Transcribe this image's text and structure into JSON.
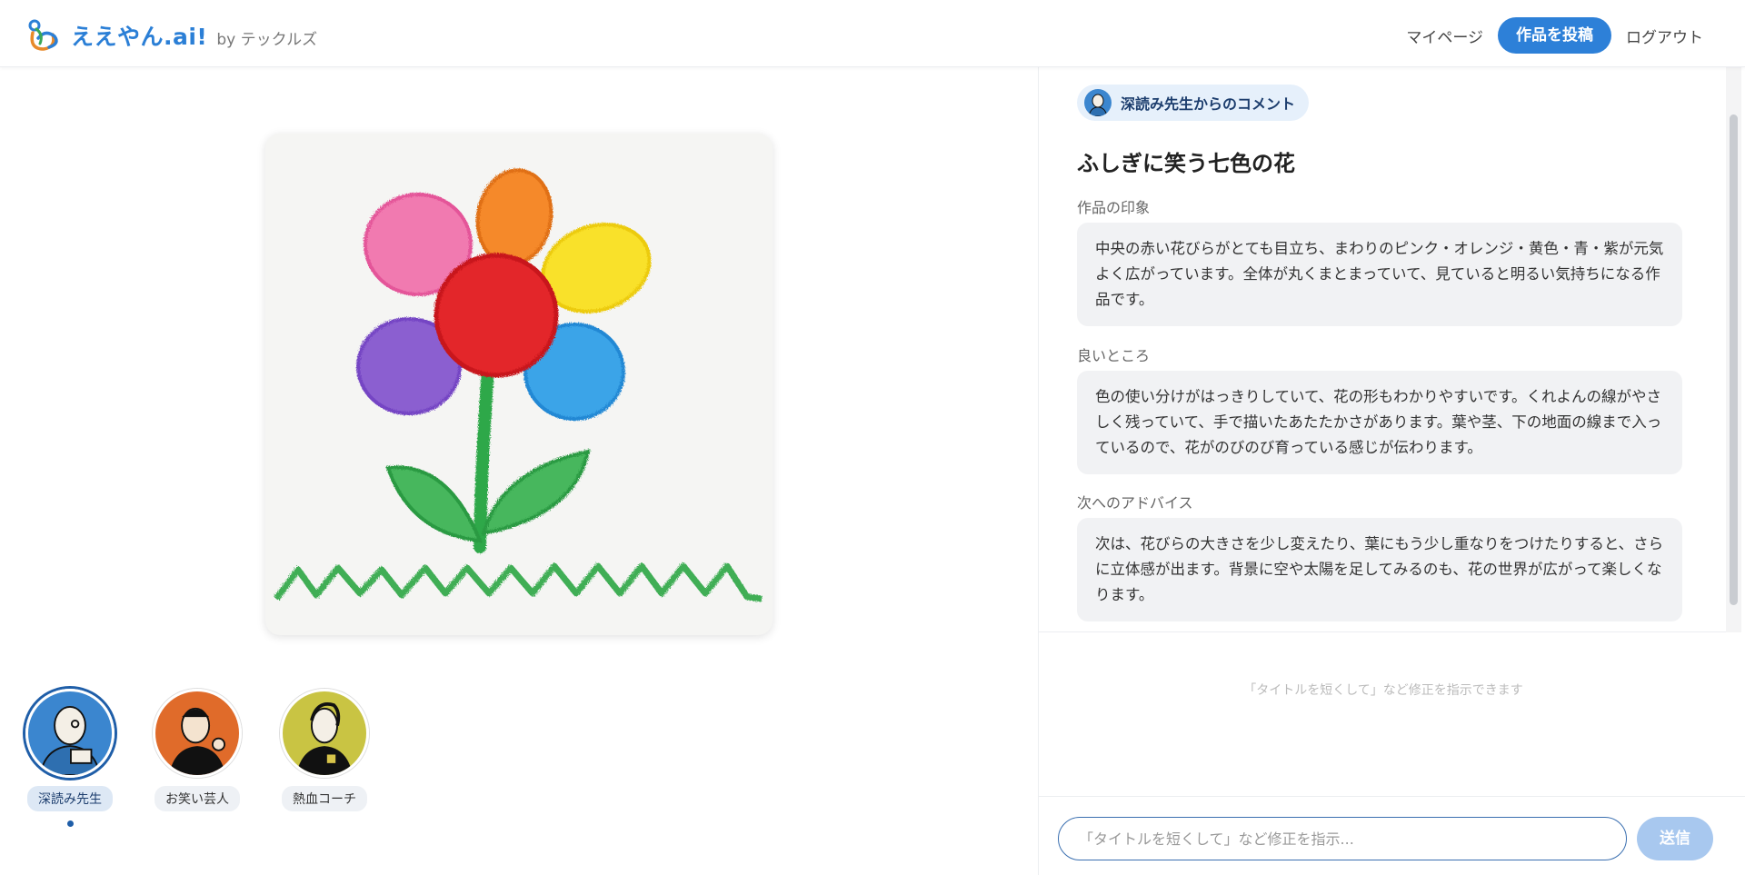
{
  "header": {
    "logo_text": "ええやん.ai!",
    "logo_by": "by テックルズ",
    "nav": {
      "mypage": "マイページ",
      "post": "作品を投稿",
      "logout": "ログアウト"
    }
  },
  "personas": [
    {
      "label": "深読み先生",
      "active": true
    },
    {
      "label": "お笑い芸人",
      "active": false
    },
    {
      "label": "熱血コーチ",
      "active": false
    }
  ],
  "comment": {
    "badge": "深読み先生からのコメント",
    "title": "ふしぎに笑う七色の花",
    "sections": [
      {
        "label": "作品の印象",
        "text": "中央の赤い花びらがとても目立ち、まわりのピンク・オレンジ・黄色・青・紫が元気よく広がっています。全体が丸くまとまっていて、見ていると明るい気持ちになる作品です。"
      },
      {
        "label": "良いところ",
        "text": "色の使い分けがはっきりしていて、花の形もわかりやすいです。くれよんの線がやさしく残っていて、手で描いたあたたかさがあります。葉や茎、下の地面の線まで入っているので、花がのびのび育っている感じが伝わります。"
      },
      {
        "label": "次へのアドバイス",
        "text": "次は、花びらの大きさを少し変えたり、葉にもう少し重なりをつけたりすると、さらに立体感が出ます。背景に空や太陽を足してみるのも、花の世界が広がって楽しくなります。"
      }
    ]
  },
  "chat": {
    "hint": "「タイトルを短くして」など修正を指示できます",
    "placeholder": "「タイトルを短くして」など修正を指示...",
    "send": "送信"
  },
  "colors": {
    "accent": "#2d80d8",
    "badge_bg": "#e6f0fb",
    "persona_active_ring": "#1f5ea8",
    "send_disabled": "#a8c8ef"
  },
  "icons": [
    "logo-mark-icon",
    "teacher-avatar-icon",
    "comedian-avatar-icon",
    "coach-avatar-icon"
  ]
}
